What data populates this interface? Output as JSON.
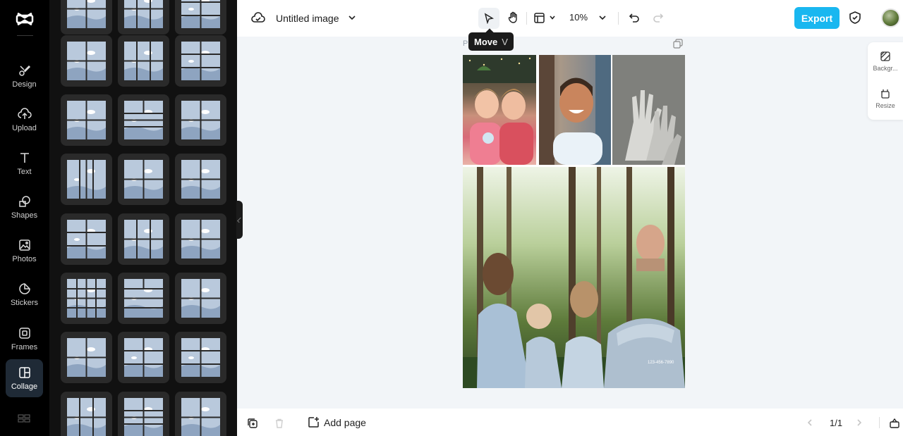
{
  "app": {
    "logo_icon": "capcut-logo-icon"
  },
  "nav": {
    "items": [
      {
        "label": "Design",
        "icon": "design-icon"
      },
      {
        "label": "Upload",
        "icon": "upload-cloud-icon"
      },
      {
        "label": "Text",
        "icon": "text-icon"
      },
      {
        "label": "Shapes",
        "icon": "shapes-icon"
      },
      {
        "label": "Photos",
        "icon": "photos-icon"
      },
      {
        "label": "Stickers",
        "icon": "stickers-icon"
      },
      {
        "label": "Frames",
        "icon": "frames-icon"
      },
      {
        "label": "Collage",
        "icon": "collage-icon",
        "active": true
      }
    ]
  },
  "topbar": {
    "title": "Untitled image",
    "zoom": "10%",
    "export_label": "Export"
  },
  "tooltip": {
    "label": "Move",
    "shortcut": "V"
  },
  "canvas": {
    "page_label": "P",
    "stamp_text": "123-456-7890"
  },
  "right_panel": {
    "background_label": "Backgr...",
    "resize_label": "Resize"
  },
  "bottombar": {
    "add_page_label": "Add page",
    "page_counter": "1/1"
  },
  "colors": {
    "accent": "#19b7f0",
    "nav_bg": "#000000",
    "panel_bg": "#111111",
    "canvas_bg": "#f2f5f8"
  }
}
